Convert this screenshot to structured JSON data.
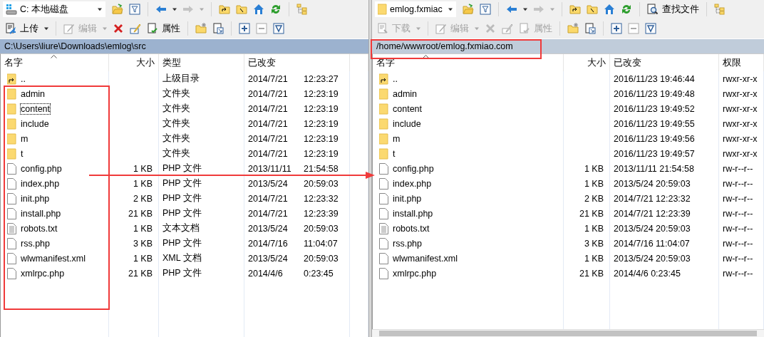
{
  "left_panel": {
    "active": true,
    "location": {
      "kind": "drive",
      "label": "C: 本地磁盘"
    },
    "toolbar": [
      {
        "kind": "open",
        "disabled": false
      },
      {
        "kind": "filter",
        "disabled": false
      },
      {
        "kind": "sep"
      },
      {
        "kind": "back",
        "disabled": false
      },
      {
        "kind": "menu",
        "disabled": false
      },
      {
        "kind": "forward",
        "disabled": true
      },
      {
        "kind": "menu",
        "disabled": true
      },
      {
        "kind": "sep"
      },
      {
        "kind": "parent",
        "disabled": false
      },
      {
        "kind": "root",
        "disabled": false
      },
      {
        "kind": "home",
        "disabled": false
      },
      {
        "kind": "refresh",
        "disabled": false
      },
      {
        "kind": "sep"
      },
      {
        "kind": "tree",
        "disabled": false
      }
    ],
    "actions": [
      {
        "kind": "upload",
        "label": "上传",
        "disabled": false
      },
      {
        "kind": "menu",
        "disabled": false
      },
      {
        "kind": "sep"
      },
      {
        "kind": "edit",
        "label": "编辑",
        "disabled": true
      },
      {
        "kind": "menu",
        "disabled": true
      },
      {
        "kind": "delete",
        "disabled": false
      },
      {
        "kind": "rename",
        "disabled": false
      },
      {
        "kind": "properties",
        "label": "属性",
        "disabled": false
      },
      {
        "kind": "sep"
      },
      {
        "kind": "new-folder",
        "disabled": false
      },
      {
        "kind": "shortcut",
        "disabled": false
      },
      {
        "kind": "sep"
      },
      {
        "kind": "select",
        "disabled": false
      },
      {
        "kind": "unselect",
        "disabled": true
      },
      {
        "kind": "filter-select",
        "disabled": false
      }
    ],
    "path": "C:\\Users\\liure\\Downloads\\emlog\\src",
    "columns": [
      "名字",
      "大小",
      "类型",
      "已改变"
    ],
    "rows": [
      {
        "kind": "parent",
        "name": "..",
        "type": "上级目录",
        "date": "2014/7/21",
        "time": "12:23:27",
        "focused": false
      },
      {
        "kind": "folder",
        "name": "admin",
        "type": "文件夹",
        "date": "2014/7/21",
        "time": "12:23:19",
        "focused": false
      },
      {
        "kind": "folder",
        "name": "content",
        "type": "文件夹",
        "date": "2014/7/21",
        "time": "12:23:19",
        "focused": true
      },
      {
        "kind": "folder",
        "name": "include",
        "type": "文件夹",
        "date": "2014/7/21",
        "time": "12:23:19",
        "focused": false
      },
      {
        "kind": "folder",
        "name": "m",
        "type": "文件夹",
        "date": "2014/7/21",
        "time": "12:23:19",
        "focused": false
      },
      {
        "kind": "folder",
        "name": "t",
        "type": "文件夹",
        "date": "2014/7/21",
        "time": "12:23:19",
        "focused": false
      },
      {
        "kind": "file",
        "name": "config.php",
        "size": "1 KB",
        "type": "PHP 文件",
        "date": "2013/11/11",
        "time": "21:54:58",
        "focused": false
      },
      {
        "kind": "file",
        "name": "index.php",
        "size": "1 KB",
        "type": "PHP 文件",
        "date": "2013/5/24",
        "time": "20:59:03",
        "focused": false
      },
      {
        "kind": "file",
        "name": "init.php",
        "size": "2 KB",
        "type": "PHP 文件",
        "date": "2014/7/21",
        "time": "12:23:32",
        "focused": false
      },
      {
        "kind": "file",
        "name": "install.php",
        "size": "21 KB",
        "type": "PHP 文件",
        "date": "2014/7/21",
        "time": "12:23:39",
        "focused": false
      },
      {
        "kind": "text",
        "name": "robots.txt",
        "size": "1 KB",
        "type": "文本文档",
        "date": "2013/5/24",
        "time": "20:59:03",
        "focused": false
      },
      {
        "kind": "file",
        "name": "rss.php",
        "size": "3 KB",
        "type": "PHP 文件",
        "date": "2014/7/16",
        "time": "11:04:07",
        "focused": false
      },
      {
        "kind": "file",
        "name": "wlwmanifest.xml",
        "size": "1 KB",
        "type": "XML 文档",
        "date": "2013/5/24",
        "time": "20:59:03",
        "focused": false
      },
      {
        "kind": "file",
        "name": "xmlrpc.php",
        "size": "21 KB",
        "type": "PHP 文件",
        "date": "2014/4/6",
        "time": "0:23:45",
        "focused": false
      }
    ]
  },
  "right_panel": {
    "active": false,
    "location": {
      "kind": "folder",
      "label": "emlog.fxmiac"
    },
    "toolbar": [
      {
        "kind": "open",
        "disabled": false
      },
      {
        "kind": "filter",
        "disabled": false
      },
      {
        "kind": "sep"
      },
      {
        "kind": "back",
        "disabled": false
      },
      {
        "kind": "menu",
        "disabled": false
      },
      {
        "kind": "forward",
        "disabled": true
      },
      {
        "kind": "menu",
        "disabled": true
      },
      {
        "kind": "sep"
      },
      {
        "kind": "parent",
        "disabled": false
      },
      {
        "kind": "root",
        "disabled": false
      },
      {
        "kind": "home",
        "disabled": false
      },
      {
        "kind": "refresh",
        "disabled": false
      },
      {
        "kind": "sep"
      },
      {
        "kind": "find",
        "label": "查找文件",
        "disabled": false
      },
      {
        "kind": "sep"
      },
      {
        "kind": "tree",
        "disabled": false
      }
    ],
    "actions": [
      {
        "kind": "download",
        "label": "下载",
        "disabled": true
      },
      {
        "kind": "menu",
        "disabled": true
      },
      {
        "kind": "sep"
      },
      {
        "kind": "edit",
        "label": "编辑",
        "disabled": true
      },
      {
        "kind": "menu",
        "disabled": true
      },
      {
        "kind": "delete",
        "disabled": true
      },
      {
        "kind": "rename",
        "disabled": true
      },
      {
        "kind": "properties",
        "label": "属性",
        "disabled": true
      },
      {
        "kind": "sep"
      },
      {
        "kind": "new-folder",
        "disabled": false
      },
      {
        "kind": "shortcut",
        "disabled": false
      },
      {
        "kind": "sep"
      },
      {
        "kind": "select",
        "disabled": false
      },
      {
        "kind": "unselect",
        "disabled": true
      },
      {
        "kind": "filter-select",
        "disabled": false
      }
    ],
    "path": "/home/wwwroot/emlog.fxmiao.com",
    "columns": [
      "名字",
      "大小",
      "已改变",
      "权限"
    ],
    "rows": [
      {
        "kind": "parent",
        "name": "..",
        "changed": "2016/11/23 19:46:44",
        "rights": "rwxr-xr-x"
      },
      {
        "kind": "folder",
        "name": "admin",
        "changed": "2016/11/23 19:49:48",
        "rights": "rwxr-xr-x"
      },
      {
        "kind": "folder",
        "name": "content",
        "changed": "2016/11/23 19:49:52",
        "rights": "rwxr-xr-x"
      },
      {
        "kind": "folder",
        "name": "include",
        "changed": "2016/11/23 19:49:55",
        "rights": "rwxr-xr-x"
      },
      {
        "kind": "folder",
        "name": "m",
        "changed": "2016/11/23 19:49:56",
        "rights": "rwxr-xr-x"
      },
      {
        "kind": "folder",
        "name": "t",
        "changed": "2016/11/23 19:49:57",
        "rights": "rwxr-xr-x"
      },
      {
        "kind": "file",
        "name": "config.php",
        "size": "1 KB",
        "changed": "2013/11/11 21:54:58",
        "rights": "rw-r--r--"
      },
      {
        "kind": "file",
        "name": "index.php",
        "size": "1 KB",
        "changed": "2013/5/24 20:59:03",
        "rights": "rw-r--r--"
      },
      {
        "kind": "file",
        "name": "init.php",
        "size": "2 KB",
        "changed": "2014/7/21 12:23:32",
        "rights": "rw-r--r--"
      },
      {
        "kind": "file",
        "name": "install.php",
        "size": "21 KB",
        "changed": "2014/7/21 12:23:39",
        "rights": "rw-r--r--"
      },
      {
        "kind": "text",
        "name": "robots.txt",
        "size": "1 KB",
        "changed": "2013/5/24 20:59:03",
        "rights": "rw-r--r--"
      },
      {
        "kind": "file",
        "name": "rss.php",
        "size": "3 KB",
        "changed": "2014/7/16 11:04:07",
        "rights": "rw-r--r--"
      },
      {
        "kind": "file",
        "name": "wlwmanifest.xml",
        "size": "1 KB",
        "changed": "2013/5/24 20:59:03",
        "rights": "rw-r--r--"
      },
      {
        "kind": "file",
        "name": "xmlrpc.php",
        "size": "21 KB",
        "changed": "2014/4/6 0:23:45",
        "rights": "rw-r--r--"
      }
    ]
  }
}
